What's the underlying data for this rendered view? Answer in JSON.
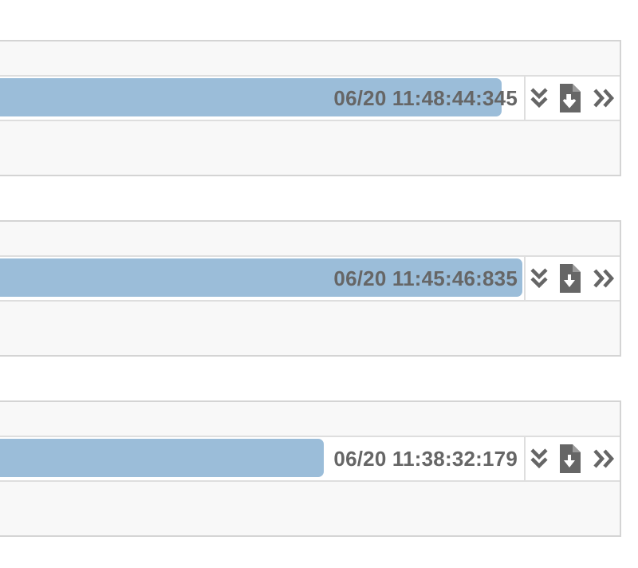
{
  "colors": {
    "bar": "#9bbdd9",
    "icon": "#666666",
    "panel_bg": "#f8f8f8",
    "border": "#d4d4d4"
  },
  "rows": [
    {
      "timestamp": "06/20 11:48:44:345",
      "progress_percent": 96,
      "icons": [
        "expand-all-icon",
        "download-file-icon",
        "next-icon"
      ]
    },
    {
      "timestamp": "06/20 11:45:46:835",
      "progress_percent": 100,
      "icons": [
        "expand-all-icon",
        "download-file-icon",
        "next-icon"
      ]
    },
    {
      "timestamp": "06/20 11:38:32:179",
      "progress_percent": 62,
      "icons": [
        "expand-all-icon",
        "download-file-icon",
        "next-icon"
      ]
    }
  ]
}
